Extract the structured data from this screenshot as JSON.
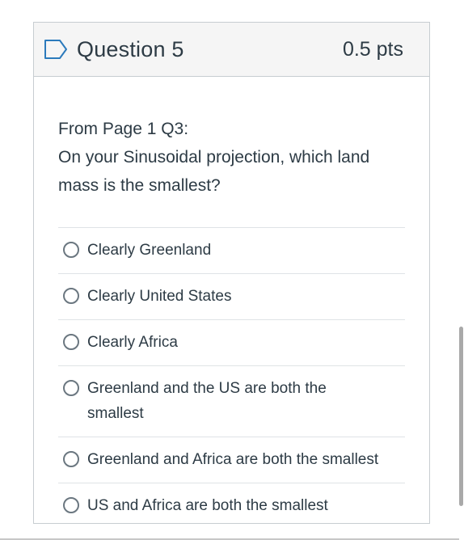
{
  "question": {
    "title": "Question 5",
    "points": "0.5 pts",
    "icon": "flag-icon",
    "text_lines": [
      "From Page 1 Q3:",
      "On your Sinusoidal projection, which land mass is the smallest?"
    ]
  },
  "answers": [
    {
      "label": "Clearly Greenland"
    },
    {
      "label": "Clearly United States"
    },
    {
      "label": "Clearly Africa"
    },
    {
      "label": "Greenland and the US are both the smallest"
    },
    {
      "label": "Greenland and Africa are both the smallest"
    },
    {
      "label": "US and Africa are both the smallest"
    }
  ],
  "colors": {
    "text": "#2d3b45",
    "header_bg": "#f5f5f5",
    "border": "#c7cdd1"
  }
}
